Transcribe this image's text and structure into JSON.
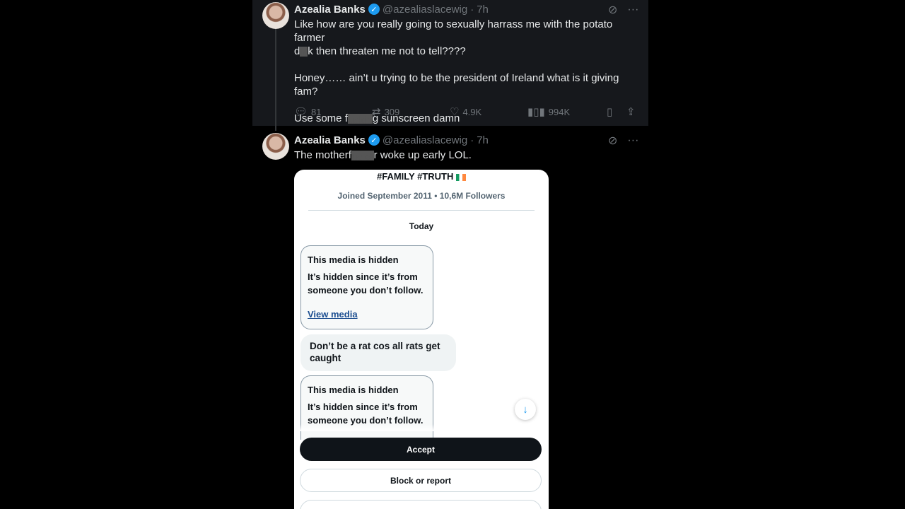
{
  "tweets": [
    {
      "name": "Azealia Banks",
      "handle": "@azealiaslacewig",
      "separator": "·",
      "time": "7h",
      "line1": "Like how are you really going to sexually harrass me with the potato farmer",
      "line2_pre": "d",
      "line2_censor": "ic",
      "line2_post": "k then threaten me not to tell????",
      "para2": "Honey…… ain’t u trying to be the president of Ireland what is it giving fam?",
      "para3_pre": "Use some f",
      "para3_censor": "uckin",
      "para3_post": "g sunscreen damn",
      "replies": "81",
      "retweets": "309",
      "likes": "4.9K",
      "views": "994K"
    },
    {
      "name": "Azealia Banks",
      "handle": "@azealiaslacewig",
      "separator": "·",
      "time": "7h",
      "text_pre": "The motherf",
      "text_censor": "ucke",
      "text_post": "r woke up early LOL."
    }
  ],
  "screenshot": {
    "tags": "#FAMILY #TRUTH",
    "joined": "Joined September 2011 • 10,6M Followers",
    "date_label": "Today",
    "hidden1_title": "This media is hidden",
    "hidden1_body": "It’s hidden since it’s from someone you don’t follow.",
    "hidden1_link": "View media",
    "message": "Don’t be a rat cos all rats get caught",
    "hidden2_title": "This media is hidden",
    "hidden2_body": "It’s hidden since it’s from someone you don’t follow.",
    "accept_label": "Accept",
    "block_label": "Block or report"
  },
  "icons": {
    "reply": "reply-icon",
    "retweet": "retweet-icon",
    "like": "like-icon",
    "views": "views-icon",
    "bookmark": "bookmark-icon",
    "share": "share-icon",
    "grok": "grok-icon",
    "more": "more-icon",
    "verified": "verified-badge-icon",
    "scroll_down": "arrow-down-icon"
  },
  "colors": {
    "verified": "#1d9bf0",
    "link": "#1d4f91",
    "muted": "#71767b"
  }
}
